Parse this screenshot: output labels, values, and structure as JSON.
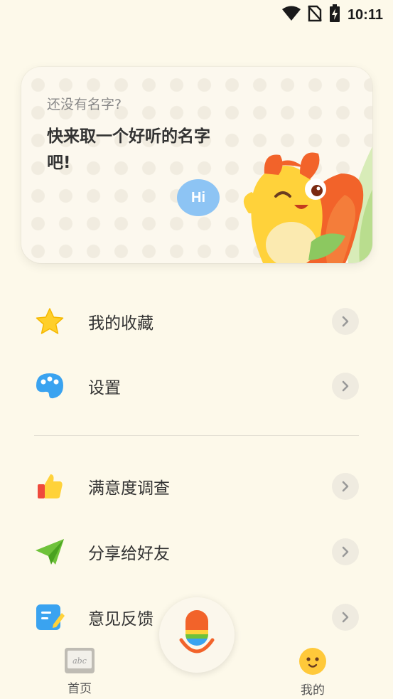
{
  "status_bar": {
    "time": "10:11",
    "icons": [
      "wifi-icon",
      "no-sim-icon",
      "battery-charging-icon"
    ]
  },
  "profile_card": {
    "hint": "还没有名字?",
    "title": "快来取一个好听的名字吧!",
    "bubble_text": "Hi"
  },
  "menu": {
    "items": [
      {
        "label": "我的收藏",
        "icon": "star-icon"
      },
      {
        "label": "设置",
        "icon": "palette-icon"
      },
      {
        "label": "满意度调查",
        "icon": "thumbs-up-icon"
      },
      {
        "label": "分享给好友",
        "icon": "paper-plane-icon"
      },
      {
        "label": "意见反馈",
        "icon": "feedback-note-icon"
      }
    ]
  },
  "bottom_nav": {
    "tabs": [
      {
        "label": "首页",
        "icon": "chalkboard-icon",
        "icon_text": "abc"
      },
      {
        "label": "我的",
        "icon": "smiley-face-icon"
      }
    ],
    "center_button": "microphone-icon"
  },
  "colors": {
    "background": "#fdf9ea",
    "bubble": "#8dc4f4",
    "mascot_orange": "#f2632a",
    "mascot_yellow": "#ffd23a"
  }
}
